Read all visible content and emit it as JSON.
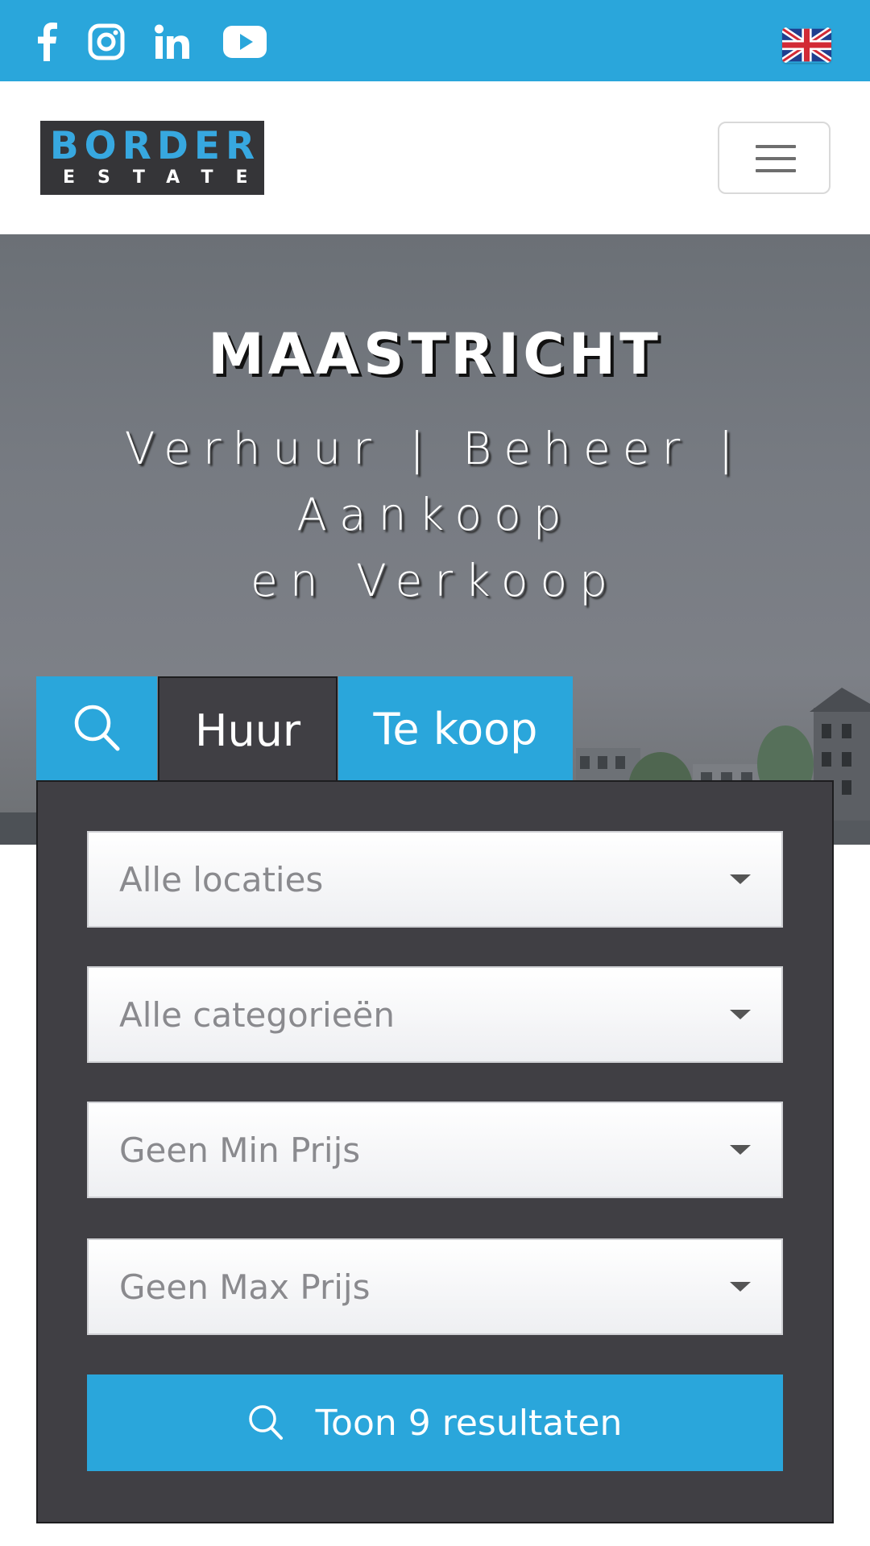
{
  "topbar": {
    "accent_color": "#2aa6db",
    "social_icons": [
      "facebook-icon",
      "instagram-icon",
      "linkedin-icon",
      "youtube-icon"
    ],
    "language_flag": "uk-flag-icon"
  },
  "header": {
    "logo": {
      "line1": "BORDER",
      "line2": "ESTATE"
    },
    "menu_icon": "hamburger-menu-icon"
  },
  "hero": {
    "title": "MAASTRICHT",
    "subtitle_line1": "Verhuur | Beheer | Aankoop",
    "subtitle_line2": "en Verkoop"
  },
  "search": {
    "tabs": [
      {
        "label": "",
        "icon": "search-icon"
      },
      {
        "label": "Huur",
        "active": true
      },
      {
        "label": "Te koop"
      }
    ],
    "selects": [
      {
        "label": "Alle locaties"
      },
      {
        "label": "Alle categorieën"
      },
      {
        "label": "Geen Min Prijs"
      },
      {
        "label": "Geen Max Prijs"
      }
    ],
    "submit_label": "Toon 9 resultaten",
    "submit_icon": "search-icon"
  }
}
